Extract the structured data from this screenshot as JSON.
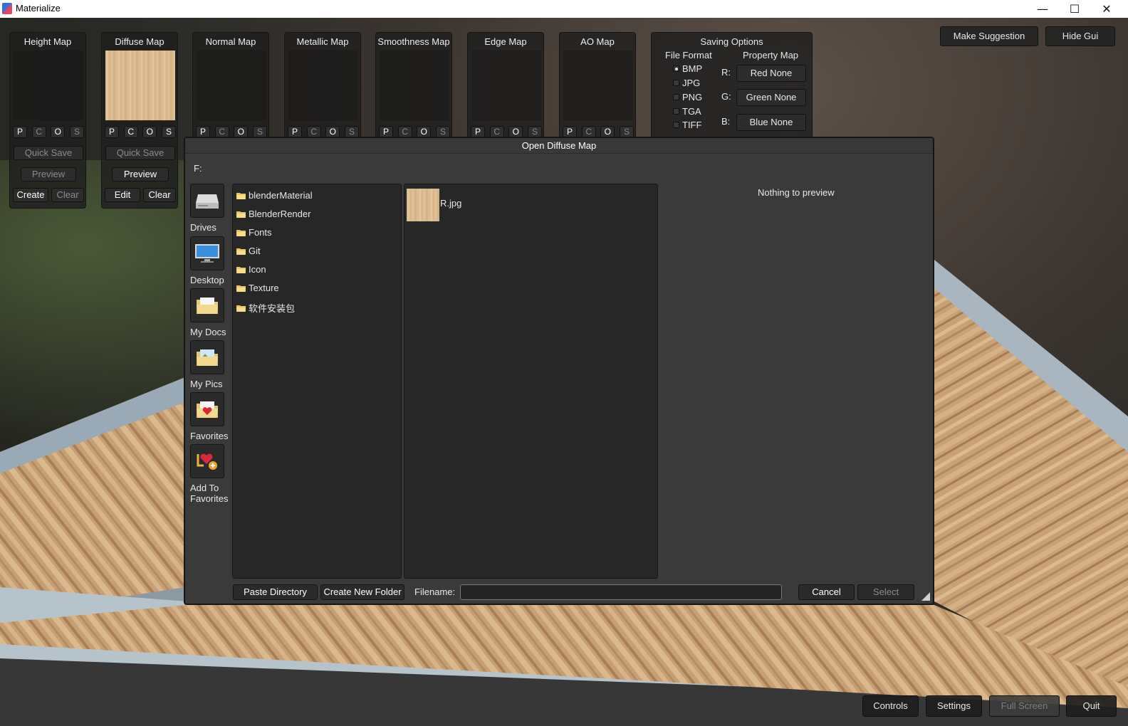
{
  "window": {
    "title": "Materialize",
    "minimize": "—",
    "maximize": "☐",
    "close": "✕"
  },
  "maps": [
    {
      "title": "Height Map",
      "pcos": [
        "P",
        "C",
        "O",
        "S"
      ],
      "quick_save": "Quick Save",
      "preview": "Preview",
      "left_btn": "Create",
      "right_btn": "Clear",
      "has_image": false
    },
    {
      "title": "Diffuse Map",
      "pcos": [
        "P",
        "C",
        "O",
        "S"
      ],
      "quick_save": "Quick Save",
      "preview": "Preview",
      "left_btn": "Edit",
      "right_btn": "Clear",
      "has_image": true
    },
    {
      "title": "Normal Map",
      "pcos": [
        "P",
        "C",
        "O",
        "S"
      ]
    },
    {
      "title": "Metallic Map",
      "pcos": [
        "P",
        "C",
        "O",
        "S"
      ]
    },
    {
      "title": "Smoothness Map",
      "pcos": [
        "P",
        "C",
        "O",
        "S"
      ]
    },
    {
      "title": "Edge Map",
      "pcos": [
        "P",
        "C",
        "O",
        "S"
      ]
    },
    {
      "title": "AO Map",
      "pcos": [
        "P",
        "C",
        "O",
        "S"
      ]
    }
  ],
  "saving_options": {
    "title": "Saving Options",
    "file_format_title": "File Format",
    "property_map_title": "Property Map",
    "formats": [
      "BMP",
      "JPG",
      "PNG",
      "TGA",
      "TIFF"
    ],
    "selected_format": "BMP",
    "channels": [
      {
        "label": "R:",
        "value": "Red None"
      },
      {
        "label": "G:",
        "value": "Green None"
      },
      {
        "label": "B:",
        "value": "Blue None"
      }
    ]
  },
  "top_right": {
    "make_suggestion": "Make Suggestion",
    "hide_gui": "Hide Gui"
  },
  "dialog": {
    "title": "Open Diffuse Map",
    "path": "F:",
    "sidebar": [
      {
        "label": "Drives",
        "icon": "drive-icon"
      },
      {
        "label": "Desktop",
        "icon": "monitor-icon"
      },
      {
        "label": "My Docs",
        "icon": "folder-docs-icon"
      },
      {
        "label": "My Pics",
        "icon": "folder-pics-icon"
      },
      {
        "label": "Favorites",
        "icon": "folder-heart-icon"
      },
      {
        "label": "Add To Favorites",
        "icon": "add-favorite-icon"
      }
    ],
    "folders": [
      "blenderMaterial",
      "BlenderRender",
      "Fonts",
      "Git",
      "Icon",
      "Texture",
      "软件安装包"
    ],
    "files": [
      {
        "name": "R.jpg"
      }
    ],
    "preview_text": "Nothing to preview",
    "paste_directory": "Paste Directory",
    "create_new_folder": "Create New Folder",
    "filename_label": "Filename:",
    "filename_value": "",
    "cancel": "Cancel",
    "select": "Select"
  },
  "bottom_right": {
    "controls": "Controls",
    "settings": "Settings",
    "full_screen": "Full Screen",
    "quit": "Quit"
  }
}
